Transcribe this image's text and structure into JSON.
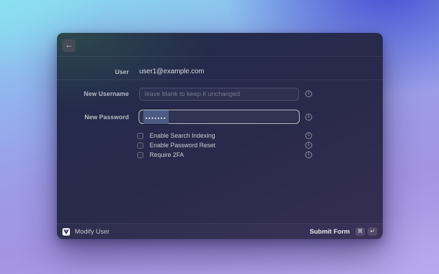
{
  "colors": {
    "bg_top_left": "#8ce2f2",
    "bg_top_right": "#4649d2",
    "bg_bottom": "#b4a7ea",
    "window_top": "#232b4d",
    "window_bottom": "#372e54",
    "selection_highlight": "#4d5c84",
    "focus_border": "#e9ecf3"
  },
  "icons": {
    "back": "←",
    "info": "i",
    "command_key": "⌘",
    "enter_key": "↵"
  },
  "form": {
    "user": {
      "label": "User",
      "value": "user1@example.com"
    },
    "new_username": {
      "label": "New Username",
      "placeholder": "leave blank to keep it unchanged",
      "value": ""
    },
    "new_password": {
      "label": "New Password",
      "masked_value": "•••••••"
    },
    "checkboxes": [
      {
        "label": "Enable Search Indexing",
        "checked": false
      },
      {
        "label": "Enable Password Reset",
        "checked": false
      },
      {
        "label": "Require 2FA",
        "checked": false
      }
    ]
  },
  "footer": {
    "title": "Modify User",
    "action_label": "Submit Form",
    "shortcut": [
      "⌘",
      "↵"
    ]
  }
}
